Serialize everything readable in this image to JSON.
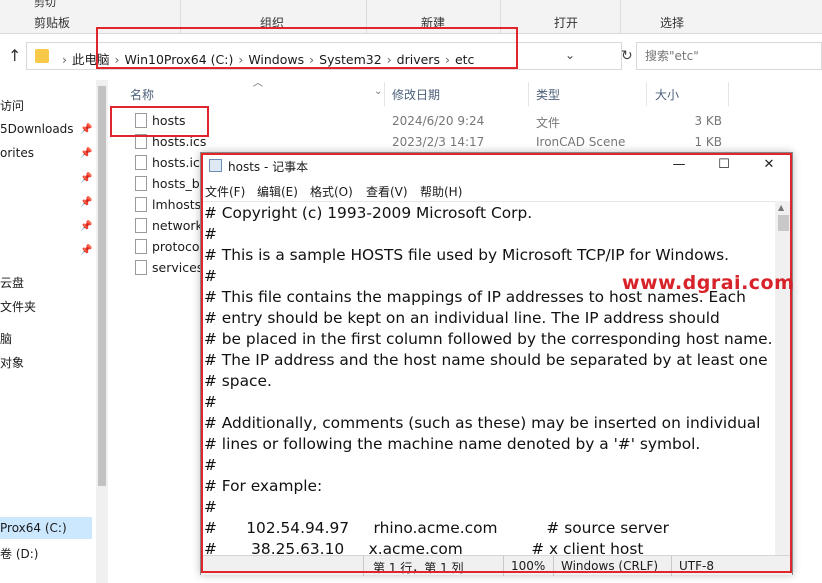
{
  "ribbon": {
    "top_label": "剪切",
    "clipboard": "剪贴板",
    "organize": "组织",
    "new": "新建",
    "open": "打开",
    "select": "选择"
  },
  "address": {
    "breadcrumbs": [
      "此电脑",
      "Win10Prox64 (C:)",
      "Windows",
      "System32",
      "drivers",
      "etc"
    ],
    "separator": "›",
    "search_placeholder": "搜索\"etc\""
  },
  "leftnav": {
    "items": [
      {
        "label": "访问"
      },
      {
        "label": "5Downloads",
        "pinned": true
      },
      {
        "label": "orites",
        "pinned": true
      },
      {
        "label": "",
        "pinned": true
      },
      {
        "label": "",
        "pinned": true
      },
      {
        "label": "",
        "pinned": true
      },
      {
        "label": "",
        "pinned": true
      },
      {
        "label": "云盘"
      },
      {
        "label": "文件夹"
      },
      {
        "label": "脑"
      },
      {
        "label": "对象"
      },
      {
        "label": "Prox64 (C:)",
        "selected": true
      },
      {
        "label": "卷 (D:)"
      }
    ],
    "pin_icon": "pin-icon"
  },
  "filelist": {
    "columns": {
      "name": "名称",
      "date": "修改日期",
      "type": "类型",
      "size": "大小"
    },
    "rows": [
      {
        "name": "hosts",
        "date": "2024/6/20 9:24",
        "type": "文件",
        "size": "3 KB"
      },
      {
        "name": "hosts.ics",
        "date": "2023/2/3 14:17",
        "type": "IronCAD Scene",
        "size": "1 KB"
      },
      {
        "name": "hosts.ics",
        "date": "",
        "type": "",
        "size": ""
      },
      {
        "name": "hosts_ba",
        "date": "",
        "type": "",
        "size": ""
      },
      {
        "name": "lmhosts.",
        "date": "",
        "type": "",
        "size": ""
      },
      {
        "name": "network",
        "date": "",
        "type": "",
        "size": ""
      },
      {
        "name": "protoco",
        "date": "",
        "type": "",
        "size": ""
      },
      {
        "name": "services",
        "date": "",
        "type": "",
        "size": ""
      }
    ]
  },
  "notepad": {
    "title": "hosts - 记事本",
    "menu": [
      "文件(F)",
      "编辑(E)",
      "格式(O)",
      "查看(V)",
      "帮助(H)"
    ],
    "lines": [
      "# Copyright (c) 1993-2009 Microsoft Corp.",
      "#",
      "# This is a sample HOSTS file used by Microsoft TCP/IP for Windows.",
      "#",
      "# This file contains the mappings of IP addresses to host names. Each",
      "# entry should be kept on an individual line. The IP address should",
      "# be placed in the first column followed by the corresponding host name.",
      "# The IP address and the host name should be separated by at least one",
      "# space.",
      "#",
      "# Additionally, comments (such as these) may be inserted on individual",
      "# lines or following the machine name denoted by a '#' symbol.",
      "#",
      "# For example:",
      "#",
      "#      102.54.94.97     rhino.acme.com          # source server",
      "#       38.25.63.10     x.acme.com              # x client host"
    ],
    "status": {
      "position": "第 1 行，第 1 列",
      "zoom": "100%",
      "line_ending": "Windows (CRLF)",
      "encoding": "UTF-8"
    },
    "buttons": {
      "minimize": "—",
      "maximize": "☐",
      "close": "✕"
    }
  },
  "watermark": "www.dgrai.com",
  "colors": {
    "highlight": "#e0262b",
    "selection": "#cce8ff"
  }
}
